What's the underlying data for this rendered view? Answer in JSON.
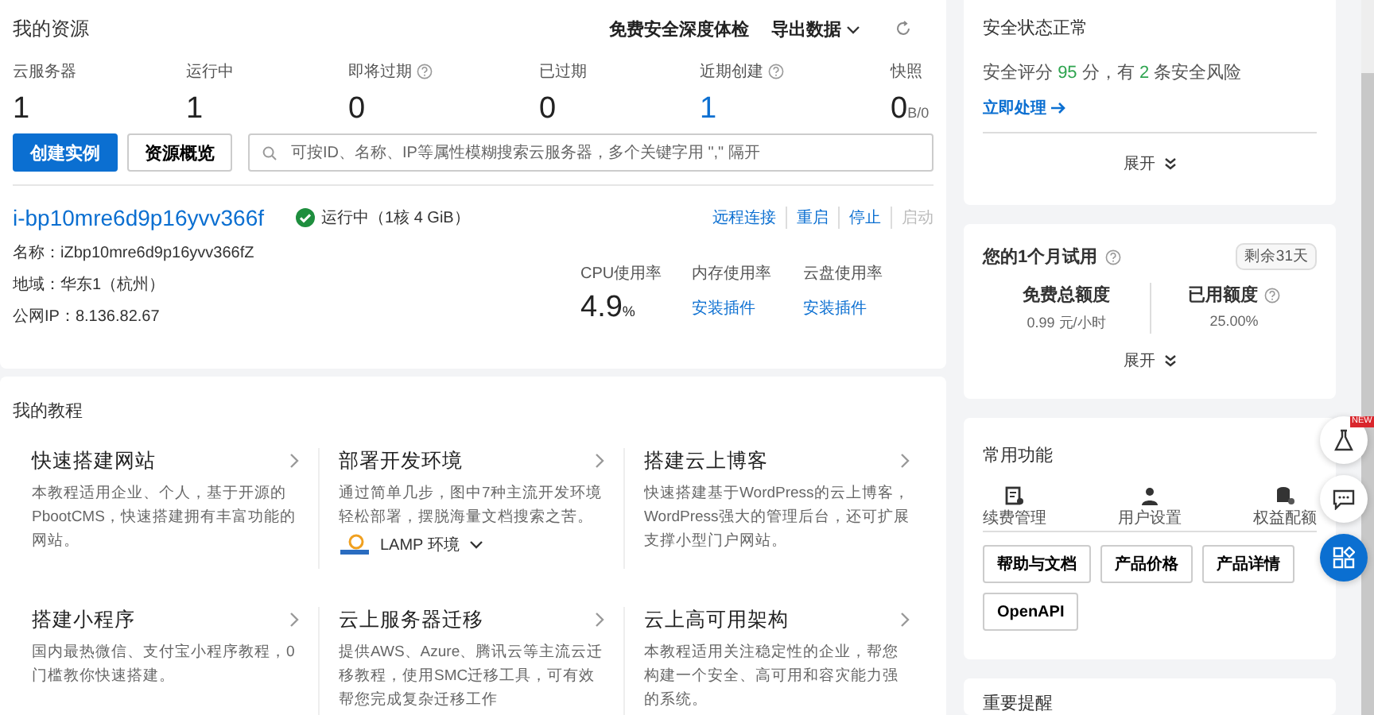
{
  "resources": {
    "title": "我的资源",
    "header_actions": [
      {
        "label": "免费安全深度体检",
        "kind": "link"
      },
      {
        "label": "导出数据",
        "kind": "dropdown"
      },
      {
        "kind": "refresh"
      }
    ],
    "stats": [
      {
        "label": "云服务器",
        "value": "1",
        "help": false,
        "highlight": false
      },
      {
        "label": "运行中",
        "value": "1",
        "help": false,
        "highlight": false
      },
      {
        "label": "即将过期",
        "value": "0",
        "help": true,
        "highlight": false
      },
      {
        "label": "已过期",
        "value": "0",
        "help": false,
        "highlight": false
      },
      {
        "label": "近期创建",
        "value": "1",
        "help": true,
        "highlight": true
      },
      {
        "label": "快照",
        "value": "0",
        "suffix": "B/0",
        "help": false,
        "highlight": false
      }
    ],
    "buttons": [
      {
        "label": "创建实例",
        "primary": true
      },
      {
        "label": "资源概览",
        "primary": false
      }
    ],
    "search": {
      "placeholder": "可按ID、名称、IP等属性模糊搜索云服务器，多个关键字用 \",\" 隔开"
    },
    "instance": {
      "id": "i-bp10mre6d9p16yvv366f",
      "status": "运行中",
      "spec": "（1核 4 GiB）",
      "running": true,
      "actions": [
        {
          "label": "远程连接",
          "disabled": false
        },
        {
          "label": "重启",
          "disabled": false
        },
        {
          "label": "停止",
          "disabled": false
        },
        {
          "label": "启动",
          "disabled": true
        }
      ],
      "info": [
        "名称：iZbp10mre6d9p16yvv366fZ",
        "地域：华东1（杭州）",
        "公网IP：8.136.82.67"
      ],
      "metrics": [
        {
          "label": "CPU使用率",
          "kind": "value",
          "value": "4.9",
          "unit": "%"
        },
        {
          "label": "内存使用率",
          "kind": "link",
          "value": "安装插件"
        },
        {
          "label": "云盘使用率",
          "kind": "link",
          "value": "安装插件"
        }
      ]
    }
  },
  "tutorials": {
    "title": "我的教程",
    "items": [
      {
        "title": "快速搭建网站",
        "desc": "本教程适用企业、个人，基于开源的PbootCMS，快速搭建拥有丰富功能的网站。"
      },
      {
        "title": "部署开发环境",
        "desc": "通过简单几步，图中7种主流开发环境轻松部署，摆脱海量文档搜索之苦。",
        "env": "LAMP 环境"
      },
      {
        "title": "搭建云上博客",
        "desc": "快速搭建基于WordPress的云上博客，WordPress强大的管理后台，还可扩展支撑小型门户网站。"
      },
      {
        "title": "搭建小程序",
        "desc": "国内最热微信、支付宝小程序教程，0门槛教你快速搭建。"
      },
      {
        "title": "云上服务器迁移",
        "desc": "提供AWS、Azure、腾讯云等主流云迁移教程，使用SMC迁移工具，可有效帮您完成复杂迁移工作"
      },
      {
        "title": "云上高可用架构",
        "desc": "本教程适用关注稳定性的企业，帮您构建一个安全、高可用和容灾能力强的系统。"
      }
    ]
  },
  "security": {
    "title": "安全状态正常",
    "summary": [
      {
        "text": "安全评分 ",
        "kind": "plain"
      },
      {
        "text": "95",
        "kind": "num"
      },
      {
        "text": " 分，有 ",
        "kind": "plain"
      },
      {
        "text": "2",
        "kind": "num"
      },
      {
        "text": " 条安全风险",
        "kind": "plain"
      }
    ],
    "action": "立即处理",
    "expand": "展开"
  },
  "trial": {
    "title": "您的1个月试用",
    "badge": "剩余31天",
    "quotas": [
      {
        "label": "免费总额度",
        "value": "0.99 元/小时",
        "help": false
      },
      {
        "label": "已用额度",
        "value": "25.00%",
        "help": true
      }
    ],
    "expand": "展开"
  },
  "functions": {
    "title": "常用功能",
    "shortcuts": [
      {
        "label": "续费管理",
        "kind": "bill"
      },
      {
        "label": "用户设置",
        "kind": "user"
      },
      {
        "label": "权益配额",
        "kind": "db"
      }
    ],
    "buttons": [
      "帮助与文档",
      "产品价格",
      "产品详情",
      "OpenAPI"
    ]
  },
  "notice": {
    "title": "重要提醒"
  },
  "float_badge": "NEW"
}
